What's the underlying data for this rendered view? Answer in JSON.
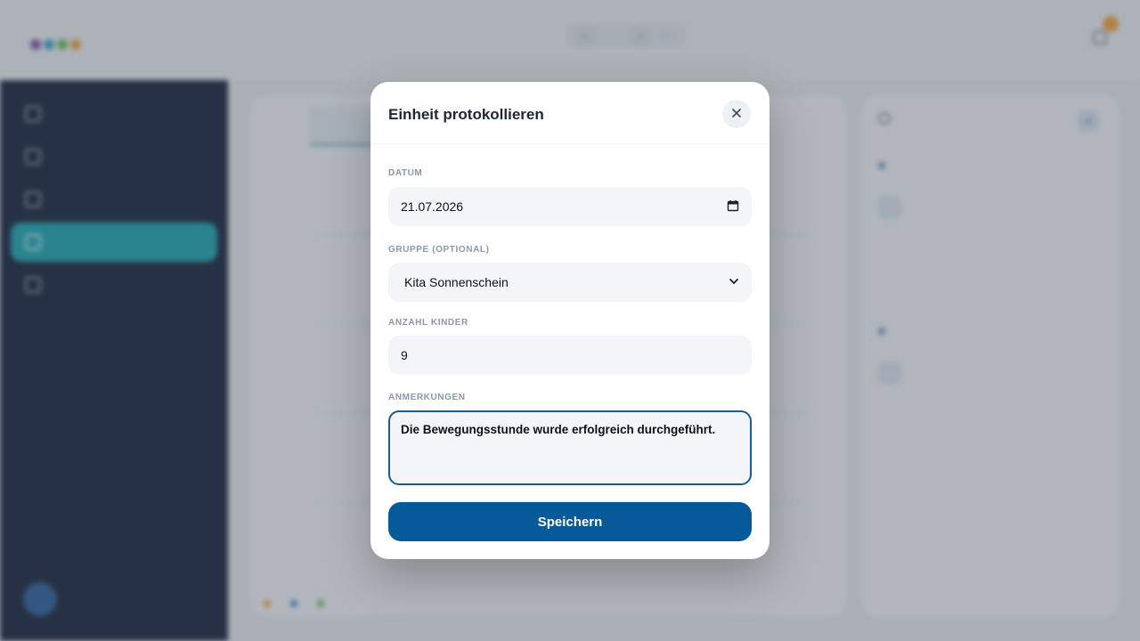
{
  "colors": {
    "sidebar_bg": "#15213a",
    "sidebar_active": "#1aa6b3",
    "primary_button": "#065a9a",
    "textarea_focus_border": "#1d5a8a"
  },
  "modal": {
    "title": "Einheit protokollieren",
    "close_icon": "close-icon",
    "datum": {
      "label": "DATUM",
      "value": "21.07.2026",
      "icon": "calendar-icon"
    },
    "gruppe": {
      "label": "GRUPPE (OPTIONAL)",
      "value": "Kita Sonnenschein",
      "icon": "chevron-down-icon"
    },
    "anzahl": {
      "label": "ANZAHL KINDER",
      "value": "9"
    },
    "anmerkungen": {
      "label": "ANMERKUNGEN",
      "value": "Die Bewegungsstunde wurde erfolgreich durchgeführt."
    },
    "save_label": "Speichern"
  }
}
